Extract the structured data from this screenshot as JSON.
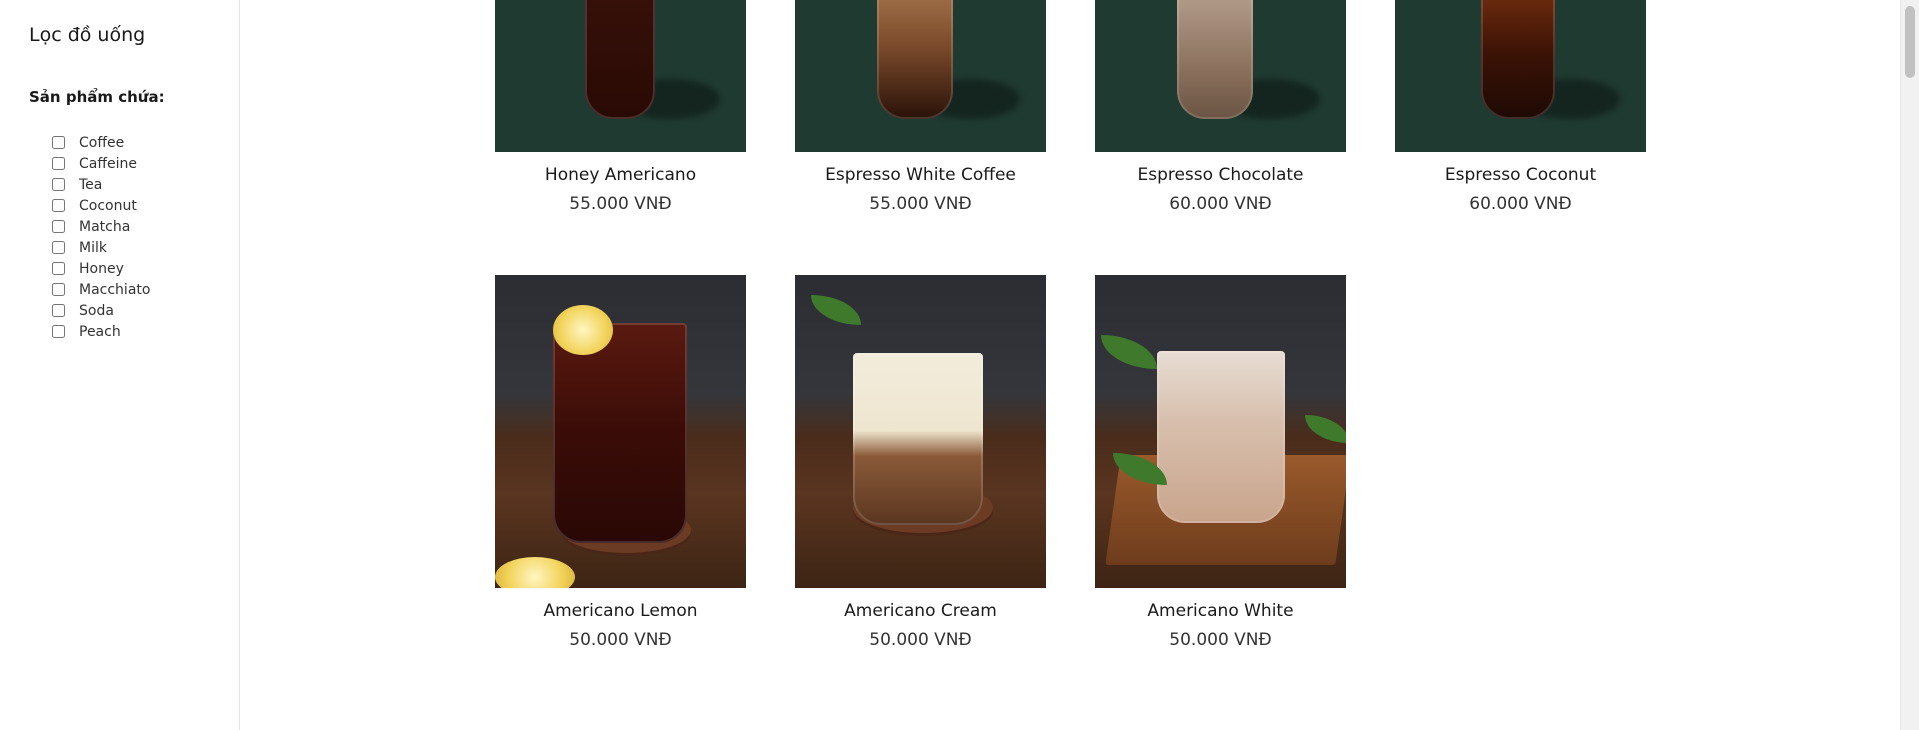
{
  "sidebar": {
    "title": "Lọc đồ uống",
    "filter_heading": "Sản phẩm chứa:",
    "filters": [
      {
        "label": "Coffee",
        "checked": false
      },
      {
        "label": "Caffeine",
        "checked": false
      },
      {
        "label": "Tea",
        "checked": false
      },
      {
        "label": "Coconut",
        "checked": false
      },
      {
        "label": "Matcha",
        "checked": false
      },
      {
        "label": "Milk",
        "checked": false
      },
      {
        "label": "Honey",
        "checked": false
      },
      {
        "label": "Macchiato",
        "checked": false
      },
      {
        "label": "Soda",
        "checked": false
      },
      {
        "label": "Peach",
        "checked": false
      }
    ]
  },
  "products": [
    {
      "name": "Honey Americano",
      "price": "55.000 VNĐ"
    },
    {
      "name": "Espresso White Coffee",
      "price": "55.000 VNĐ"
    },
    {
      "name": "Espresso Chocolate",
      "price": "60.000 VNĐ"
    },
    {
      "name": "Espresso Coconut",
      "price": "60.000 VNĐ"
    },
    {
      "name": "Americano Lemon",
      "price": "50.000 VNĐ"
    },
    {
      "name": "Americano Cream",
      "price": "50.000 VNĐ"
    },
    {
      "name": "Americano White",
      "price": "50.000 VNĐ"
    }
  ],
  "colors": {
    "product_bg_green": "#1f3a31",
    "sidebar_border": "#e4e4e4"
  }
}
